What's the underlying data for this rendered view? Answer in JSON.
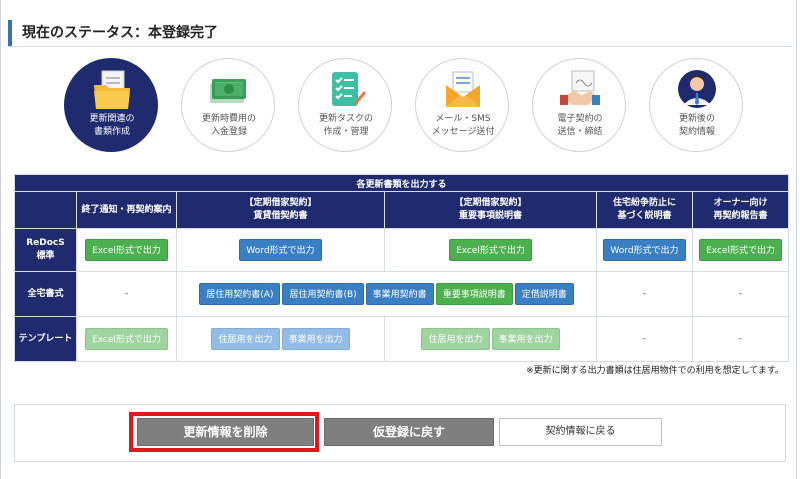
{
  "status": {
    "title": "現在のステータス：本登録完了"
  },
  "steps": [
    {
      "line1": "更新関連の",
      "line2": "書類作成",
      "icon": "folder-documents-icon",
      "active": true
    },
    {
      "line1": "更新時費用の",
      "line2": "入金登録",
      "icon": "cash-icon",
      "active": false
    },
    {
      "line1": "更新タスクの",
      "line2": "作成・管理",
      "icon": "checklist-icon",
      "active": false
    },
    {
      "line1": "メール・SMS",
      "line2": "メッセージ送付",
      "icon": "envelope-icon",
      "active": false
    },
    {
      "line1": "電子契約の",
      "line2": "送信・締結",
      "icon": "handshake-icon",
      "active": false
    },
    {
      "line1": "更新後の",
      "line2": "契約情報",
      "icon": "person-icon",
      "active": false
    }
  ],
  "table": {
    "caption": "各更新書類を出力する",
    "headers": {
      "notice": "終了通知・再契約案内",
      "lease_l1": "【定期借家契約】",
      "lease_l2": "賃貸借契約書",
      "explain_l1": "【定期借家契約】",
      "explain_l2": "重要事項説明書",
      "dispute_l1": "住宅紛争防止に",
      "dispute_l2": "基づく説明書",
      "owner_l1": "オーナー向け",
      "owner_l2": "再契約報告書"
    },
    "rows": {
      "redocs": {
        "label_l1": "ReDocS",
        "label_l2": "標準",
        "notice": "Excel形式で出力",
        "lease": "Word形式で出力",
        "explain": "Excel形式で出力",
        "dispute": "Word形式で出力",
        "owner": "Excel形式で出力"
      },
      "zentaku": {
        "label": "全宅書式",
        "notice": "-",
        "lease_a": "居住用契約書(A)",
        "lease_b": "居住用契約書(B)",
        "biz": "事業用契約書",
        "important": "重要事項説明書",
        "fixed": "定借説明書",
        "dispute": "-",
        "owner": "-"
      },
      "template": {
        "label": "テンプレート",
        "notice": "Excel形式で出力",
        "lease_res": "住居用を出力",
        "lease_biz": "事業用を出力",
        "explain_res": "住居用を出力",
        "explain_biz": "事業用を出力",
        "dispute": "-",
        "owner": "-"
      }
    }
  },
  "note": "※更新に関する出力書類は住居用物件での利用を想定してます。",
  "actions": {
    "delete": "更新情報を削除",
    "back_to_provisional": "仮登録に戻す",
    "back_to_contract": "契約情報に戻る"
  },
  "colors": {
    "navy": "#1f2b6e",
    "excel_green": "#4cb04f",
    "word_blue": "#3a7fc4",
    "highlight_red": "#e01818"
  }
}
